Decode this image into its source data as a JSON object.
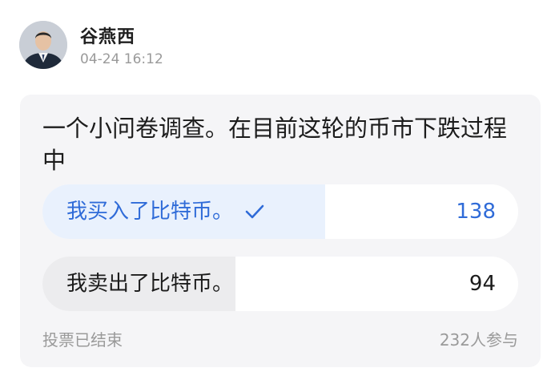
{
  "author": {
    "name": "谷燕西",
    "time": "04-24 16:12",
    "avatar_icon": "person-avatar"
  },
  "poll": {
    "question": "一个小问卷调查。在目前这轮的币市下跌过程中",
    "options": [
      {
        "label": "我买入了比特币。",
        "count": "138",
        "selected": true,
        "check_icon": "checkmark-icon",
        "share": 0.595
      },
      {
        "label": "我卖出了比特币。",
        "count": "94",
        "selected": false,
        "share": 0.405
      }
    ],
    "status": "投票已结束",
    "participants": "232人参与"
  },
  "colors": {
    "accent": "#2f6bd8",
    "selected_fill": "#e9f1fd",
    "unselected_fill": "#ececee",
    "card_bg": "#f5f5f7",
    "muted_text": "#9a9a9a"
  }
}
